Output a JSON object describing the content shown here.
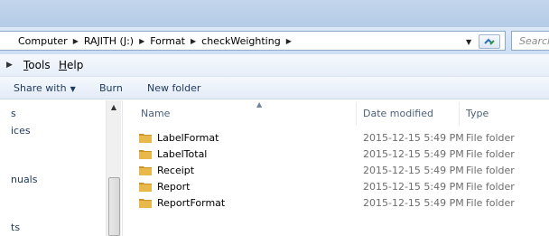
{
  "address": {
    "crumbs": [
      "Computer",
      "RAJITH (J:)",
      "Format",
      "checkWeighting"
    ],
    "search_placeholder": "Search"
  },
  "menubar": {
    "items": [
      {
        "label_underlined": "T",
        "label_rest": "ools"
      },
      {
        "label_underlined": "H",
        "label_rest": "elp"
      }
    ]
  },
  "toolbar": {
    "share_label": "Share with",
    "burn_label": "Burn",
    "new_folder_label": "New folder"
  },
  "nav": {
    "fragments": [
      "s",
      "ices",
      "nuals",
      "ts"
    ]
  },
  "columns": {
    "name": "Name",
    "date": "Date modified",
    "type": "Type"
  },
  "files": [
    {
      "name": "LabelFormat",
      "date": "2015-12-15 5:49 PM",
      "type": "File folder"
    },
    {
      "name": "LabelTotal",
      "date": "2015-12-15 5:49 PM",
      "type": "File folder"
    },
    {
      "name": "Receipt",
      "date": "2015-12-15 5:49 PM",
      "type": "File folder"
    },
    {
      "name": "Report",
      "date": "2015-12-15 5:49 PM",
      "type": "File folder"
    },
    {
      "name": "ReportFormat",
      "date": "2015-12-15 5:49 PM",
      "type": "File folder"
    }
  ],
  "colors": {
    "folder": "#e8b84a",
    "folder_dark": "#c9952b",
    "text_blue": "#1e395b"
  },
  "icons": [
    "chevron-right-icon",
    "chevron-down-icon",
    "refresh-icon",
    "folder-icon",
    "sort-up-icon",
    "scroll-up-icon"
  ]
}
